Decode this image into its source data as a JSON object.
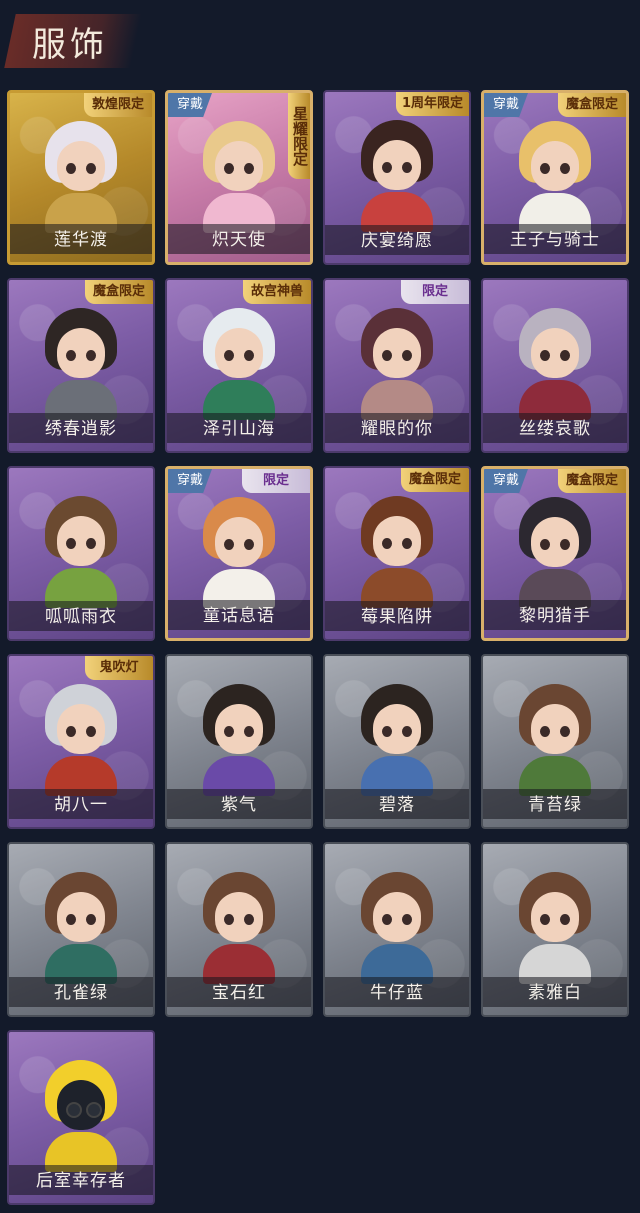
{
  "header": {
    "title": "服饰"
  },
  "badges": {
    "equipped": "穿戴"
  },
  "costumes": [
    {
      "name": "莲华渡",
      "tag": "敦煌限定",
      "style": "gold",
      "equipped": false,
      "hair": "#e7e2ec",
      "outfit": "#c9a24a"
    },
    {
      "name": "炽天使",
      "tag": "星耀限定",
      "style": "pink",
      "equipped": true,
      "hair": "#e9c98b",
      "outfit": "#f0b8d0"
    },
    {
      "name": "庆宴绮愿",
      "tag": "1周年限定",
      "style": "purple",
      "equipped": false,
      "hair": "#3a2420",
      "outfit": "#c8413e"
    },
    {
      "name": "王子与骑士",
      "tag": "魔盒限定",
      "style": "purple",
      "equipped": true,
      "hair": "#e8c06a",
      "outfit": "#f1efe8"
    },
    {
      "name": "绣春逍影",
      "tag": "魔盒限定",
      "style": "purple",
      "equipped": false,
      "hair": "#2e2624",
      "outfit": "#6b6f78"
    },
    {
      "name": "泽引山海",
      "tag": "故宫神兽",
      "style": "purple",
      "equipped": false,
      "hair": "#e6ebef",
      "outfit": "#2f7e5a"
    },
    {
      "name": "耀眼的你",
      "tag": "限定",
      "style": "purple",
      "equipped": false,
      "hair": "#5a3038",
      "outfit": "#b48a86"
    },
    {
      "name": "丝缕哀歌",
      "tag": "",
      "style": "purple",
      "equipped": false,
      "hair": "#b9b2c0",
      "outfit": "#8e2b3b"
    },
    {
      "name": "呱呱雨衣",
      "tag": "",
      "style": "purple",
      "equipped": false,
      "hair": "#6b4a30",
      "outfit": "#77a240"
    },
    {
      "name": "童话息语",
      "tag": "限定",
      "style": "purple",
      "equipped": true,
      "hair": "#d98a4a",
      "outfit": "#f3f0ea"
    },
    {
      "name": "莓果陷阱",
      "tag": "魔盒限定",
      "style": "purple",
      "equipped": false,
      "hair": "#6f3a22",
      "outfit": "#8c4b2a"
    },
    {
      "name": "黎明猎手",
      "tag": "魔盒限定",
      "style": "purple",
      "equipped": true,
      "hair": "#2c2830",
      "outfit": "#5a4a58"
    },
    {
      "name": "胡八一",
      "tag": "鬼吹灯",
      "style": "purple",
      "equipped": false,
      "hair": "#cfd2d8",
      "outfit": "#b53a2a"
    },
    {
      "name": "紫气",
      "tag": "",
      "style": "grey",
      "equipped": false,
      "hair": "#2c2420",
      "outfit": "#6a4aa8"
    },
    {
      "name": "碧落",
      "tag": "",
      "style": "grey",
      "equipped": false,
      "hair": "#2c2420",
      "outfit": "#4870b0"
    },
    {
      "name": "青苔绿",
      "tag": "",
      "style": "grey",
      "equipped": false,
      "hair": "#6a4632",
      "outfit": "#4f7a3a"
    },
    {
      "name": "孔雀绿",
      "tag": "",
      "style": "grey",
      "equipped": false,
      "hair": "#6a4632",
      "outfit": "#2f6e62"
    },
    {
      "name": "宝石红",
      "tag": "",
      "style": "grey",
      "equipped": false,
      "hair": "#6a4632",
      "outfit": "#9b2e34"
    },
    {
      "name": "牛仔蓝",
      "tag": "",
      "style": "grey",
      "equipped": false,
      "hair": "#6a4632",
      "outfit": "#3d6a98"
    },
    {
      "name": "素雅白",
      "tag": "",
      "style": "grey",
      "equipped": false,
      "hair": "#6a4632",
      "outfit": "#d6d6d6"
    },
    {
      "name": "后室幸存者",
      "tag": "",
      "style": "purple",
      "equipped": false,
      "hair": "#f2cf2b",
      "outfit": "#e8c426",
      "gasmask": true
    }
  ]
}
